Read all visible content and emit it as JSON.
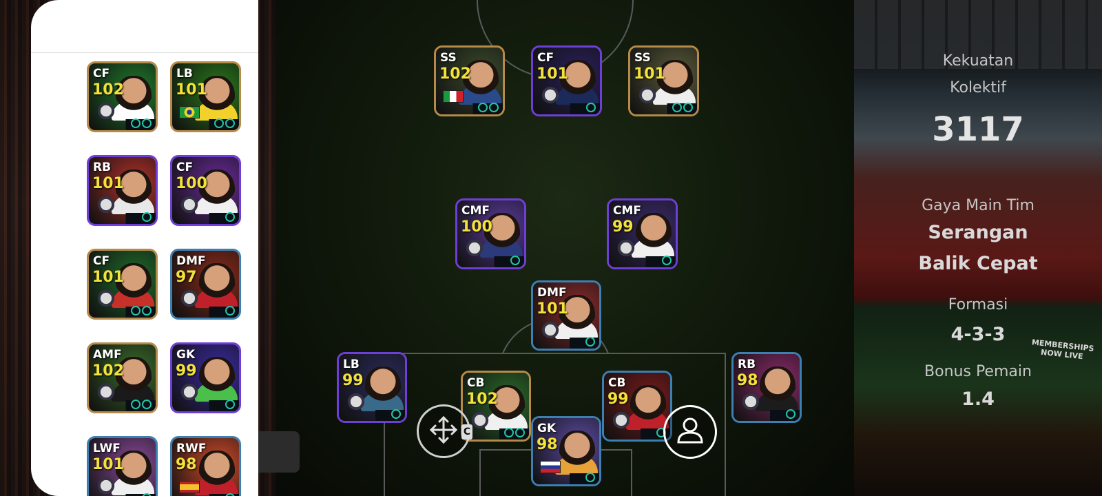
{
  "team_panel": {
    "strength_label_1": "Kekuatan",
    "strength_label_2": "Kolektif",
    "strength_value": "3117",
    "playstyle_label": "Gaya Main Tim",
    "playstyle_line1": "Serangan",
    "playstyle_line2": "Balik Cepat",
    "formation_label": "Formasi",
    "formation_value": "4-3-3",
    "bonus_label": "Bonus Pemain",
    "bonus_value": "1.4",
    "ad_board_text": "MEMBERSHIPS NOW LIVE"
  },
  "pitch_players": [
    {
      "pos": "SS",
      "rating": "102",
      "style": "gold",
      "badge": "italy-flag",
      "shirt": "#2a4a8c",
      "bg": "#3a4a2a"
    },
    {
      "pos": "CF",
      "rating": "101",
      "style": "purple",
      "badge": "psg-crest",
      "shirt": "#1c2a5a",
      "bg": "#2a1f5a"
    },
    {
      "pos": "SS",
      "rating": "101",
      "style": "gold",
      "badge": "santos-crest",
      "shirt": "#eeeeee",
      "bg": "#5a5a3a"
    },
    {
      "pos": "CMF",
      "rating": "100",
      "style": "purple",
      "badge": "barcelona-crest",
      "shirt": "#2a3a7a",
      "bg": "#5a3a9a"
    },
    {
      "pos": "CMF",
      "rating": "99",
      "style": "purple",
      "badge": "real-madrid-crest",
      "shirt": "#f0f0f0",
      "bg": "#3a2a6a"
    },
    {
      "pos": "DMF",
      "rating": "101",
      "style": "blue",
      "badge": "real-madrid-crest",
      "shirt": "#f0f0f0",
      "bg": "#8a2a2a"
    },
    {
      "pos": "LB",
      "rating": "99",
      "style": "purple",
      "badge": "inter-miami-crest",
      "shirt": "#3a6a8a",
      "bg": "#2a2a5a"
    },
    {
      "pos": "CB",
      "rating": "102",
      "style": "gold",
      "badge": "arsenal-crest",
      "shirt": "#f0f0f0",
      "bg": "#2a6a2a"
    },
    {
      "pos": "GK",
      "rating": "98",
      "style": "blue",
      "badge": "slovenia-flag",
      "shirt": "#e8a23a",
      "bg": "#5a4aa0"
    },
    {
      "pos": "CB",
      "rating": "99",
      "style": "blue",
      "badge": "man-united-crest",
      "shirt": "#c0202a",
      "bg": "#7a1a1a"
    },
    {
      "pos": "RB",
      "rating": "98",
      "style": "blue",
      "badge": "barcelona-crest",
      "shirt": "#1c1c1c",
      "bg": "#8a2a6a"
    }
  ],
  "reserve_players": [
    {
      "pos": "CF",
      "rating": "102",
      "style": "gold",
      "badge": "real-oviedo-crest",
      "shirt": "#ffffff",
      "bg": "#1f7a2a"
    },
    {
      "pos": "LB",
      "rating": "101",
      "style": "gold",
      "badge": "brazil-flag",
      "shirt": "#f2d22a",
      "bg": "#2a7a1a"
    },
    {
      "pos": "RB",
      "rating": "101",
      "style": "purple",
      "badge": "arsenal-crest",
      "shirt": "#e8e8e8",
      "bg": "#b0302a"
    },
    {
      "pos": "CF",
      "rating": "100",
      "style": "purple",
      "badge": "real-madrid-crest",
      "shirt": "#f0f0f0",
      "bg": "#6a2a9a"
    },
    {
      "pos": "CF",
      "rating": "101",
      "style": "gold",
      "badge": "galatasaray-crest",
      "shirt": "#c8302a",
      "bg": "#1f6a2a"
    },
    {
      "pos": "DMF",
      "rating": "97",
      "style": "blue",
      "badge": "man-united-crest",
      "shirt": "#c0202a",
      "bg": "#8a2a1a"
    },
    {
      "pos": "AMF",
      "rating": "102",
      "style": "gold",
      "badge": "inter-crest",
      "shirt": "#1a1a1a",
      "bg": "#3a6a2a"
    },
    {
      "pos": "GK",
      "rating": "99",
      "style": "purple",
      "badge": "bayern-crest",
      "shirt": "#4ac04a",
      "bg": "#3a2aa0"
    },
    {
      "pos": "LWF",
      "rating": "101",
      "style": "blue",
      "badge": "real-madrid-crest",
      "shirt": "#f0f0f0",
      "bg": "#8a4a9a"
    },
    {
      "pos": "RWF",
      "rating": "98",
      "style": "blue",
      "badge": "spain-flag",
      "shirt": "#c0202a",
      "bg": "#d04a2a"
    }
  ],
  "controls": {
    "move_icon": "move-arrows-icon",
    "c_key": "C",
    "profile_icon": "person-icon"
  }
}
